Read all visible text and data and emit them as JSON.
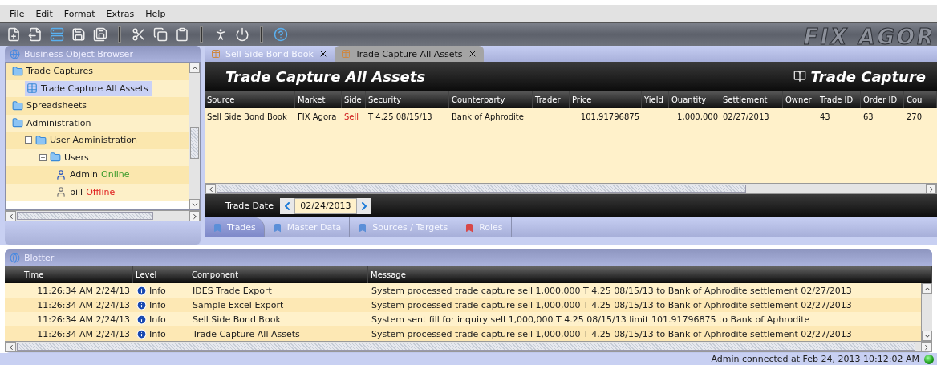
{
  "menu": [
    "File",
    "Edit",
    "Format",
    "Extras",
    "Help"
  ],
  "toolbar": {
    "logo": "FIX AGOR"
  },
  "browser": {
    "title": "Business Object Browser",
    "tree": [
      {
        "label": "Trade Captures",
        "kind": "folder",
        "selected": false,
        "children": [
          {
            "label": "Trade Capture All Assets",
            "kind": "table",
            "selected": true
          }
        ]
      },
      {
        "label": "Spreadsheets",
        "kind": "folder",
        "selected": false
      },
      {
        "label": "Administration",
        "kind": "folder",
        "selected": false,
        "children": [
          {
            "label": "User Administration",
            "kind": "folder",
            "selected": false,
            "expanded": true,
            "children": [
              {
                "label": "Users",
                "kind": "folder",
                "selected": false,
                "expanded": true,
                "children": [
                  {
                    "label": "Admin",
                    "kind": "user",
                    "selected": false,
                    "status": "Online",
                    "color": "#3a9a2a"
                  },
                  {
                    "label": "bill",
                    "kind": "user",
                    "selected": false,
                    "status": "Offline",
                    "color": "#e02020"
                  }
                ]
              }
            ]
          }
        ]
      }
    ]
  },
  "editor_tabs": [
    {
      "label": "Sell Side Bond Book",
      "selected": false
    },
    {
      "label": "Trade Capture All Assets",
      "selected": true
    }
  ],
  "view": {
    "title": "Trade Capture All Assets",
    "type": "Trade Capture",
    "table": {
      "columns": [
        {
          "label": "Source"
        },
        {
          "label": "Market"
        },
        {
          "label": "Side",
          "accent": true
        },
        {
          "label": "Security"
        },
        {
          "label": "Counterparty"
        },
        {
          "label": "Trader"
        },
        {
          "label": "Price"
        },
        {
          "label": "Yield"
        },
        {
          "label": "Quantity"
        },
        {
          "label": "Settlement"
        },
        {
          "label": "Owner"
        },
        {
          "label": "Trade ID"
        },
        {
          "label": "Order ID"
        },
        {
          "label": "Cou"
        }
      ],
      "rows": [
        [
          "Sell Side Bond Book",
          "FIX Agora",
          "Sell",
          "T 4.25 08/15/13",
          "Bank of Aphrodite",
          "",
          "101.91796875",
          "",
          "1,000,000",
          "02/27/2013",
          "",
          "43",
          "63",
          "270"
        ]
      ]
    },
    "trade_date": {
      "label": "Trade Date",
      "value": "02/24/2013"
    },
    "bottom_tabs": [
      {
        "label": "Trades",
        "selected": true,
        "color": "#5b8fd8"
      },
      {
        "label": "Master Data",
        "selected": false,
        "color": "#5b8fd8"
      },
      {
        "label": "Sources / Targets",
        "selected": false,
        "color": "#5b8fd8"
      },
      {
        "label": "Roles",
        "selected": false,
        "color": "#d84848"
      }
    ]
  },
  "blotter": {
    "title": "Blotter",
    "columns": [
      "Time",
      "Level",
      "Component",
      "Message"
    ],
    "rows": [
      {
        "time": "11:26:34 AM 2/24/13",
        "level": "Info",
        "component": "IDES Trade Export",
        "message": "System processed trade capture sell 1,000,000 T 4.25 08/15/13 to Bank of Aphrodite settlement 02/27/2013"
      },
      {
        "time": "11:26:34 AM 2/24/13",
        "level": "Info",
        "component": "Sample Excel Export",
        "message": "System processed trade capture sell 1,000,000 T 4.25 08/15/13 to Bank of Aphrodite settlement 02/27/2013"
      },
      {
        "time": "11:26:34 AM 2/24/13",
        "level": "Info",
        "component": "Sell Side Bond Book",
        "message": "System sent fill for inquiry sell 1,000,000 T 4.25 08/15/13 limit 101.91796875 to Bank of Aphrodite"
      },
      {
        "time": "11:26:34 AM 2/24/13",
        "level": "Info",
        "component": "Trade Capture All Assets",
        "message": "System processed trade capture sell 1,000,000 T 4.25 08/15/13 to Bank of Aphrodite settlement 02/27/2013"
      }
    ]
  },
  "status_bar": {
    "text": "Admin connected at Feb 24, 2013 10:12:02 AM"
  }
}
